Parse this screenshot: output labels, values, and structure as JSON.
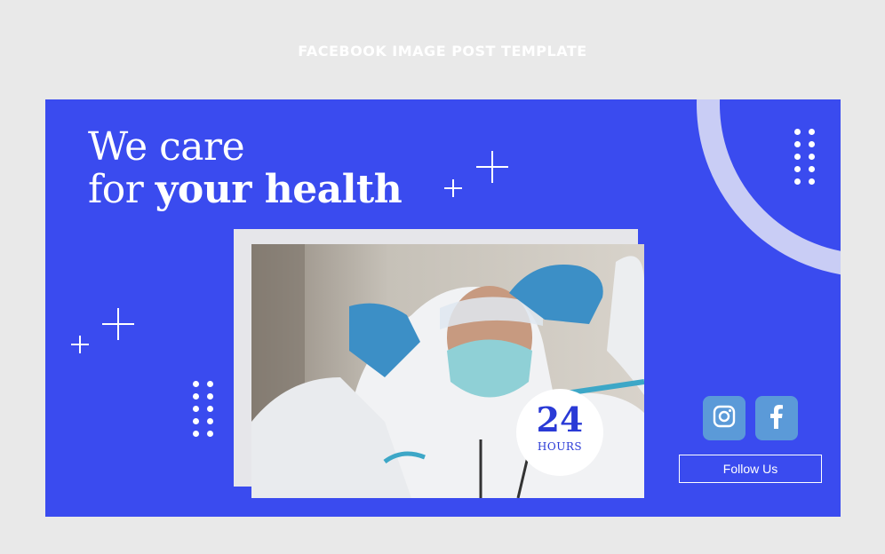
{
  "page_heading": "FACEBOOK IMAGE POST TEMPLATE",
  "headline": {
    "line1": "We care",
    "line2_prefix": "for ",
    "line2_emphasis": "your health"
  },
  "badge": {
    "number": "24",
    "label": "HOURS"
  },
  "social": {
    "icons": [
      "instagram-icon",
      "facebook-icon"
    ]
  },
  "follow_button": {
    "label": "Follow Us"
  },
  "colors": {
    "banner": "#3a4bef",
    "ring": "#c9cdf5",
    "social_button": "#5b9ad8",
    "badge_text": "#2a3ad6"
  }
}
